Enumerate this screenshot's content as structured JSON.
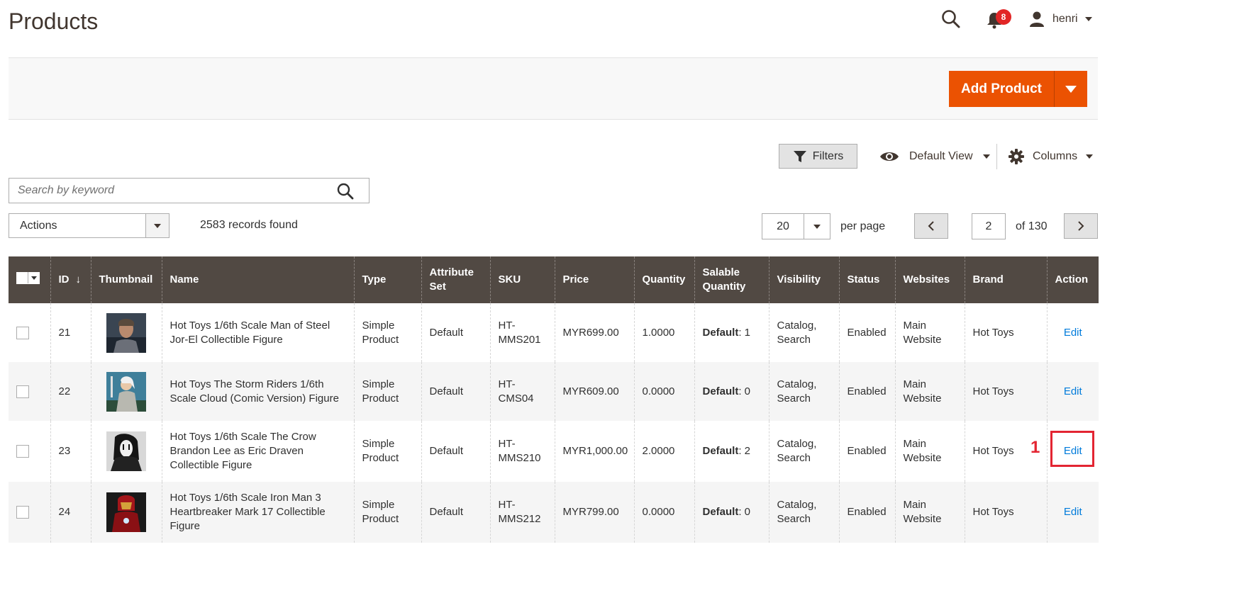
{
  "header": {
    "title": "Products",
    "notifications_count": "8",
    "username": "henri"
  },
  "toolbar": {
    "add_product_label": "Add Product"
  },
  "controls": {
    "filters_label": "Filters",
    "view_label": "Default View",
    "columns_label": "Columns",
    "search_placeholder": "Search by keyword",
    "actions_label": "Actions",
    "records_found": "2583 records found",
    "per_page_value": "20",
    "per_page_label": "per page",
    "current_page": "2",
    "total_pages_label": "of 130"
  },
  "table": {
    "columns": [
      "ID",
      "Thumbnail",
      "Name",
      "Type",
      "Attribute Set",
      "SKU",
      "Price",
      "Quantity",
      "Salable Quantity",
      "Visibility",
      "Status",
      "Websites",
      "Brand",
      "Action"
    ],
    "rows": [
      {
        "id": "21",
        "name": "Hot Toys 1/6th Scale Man of Steel Jor-El Collectible Figure",
        "type": "Simple Product",
        "attribute_set": "Default",
        "sku": "HT-MMS201",
        "price": "MYR699.00",
        "quantity": "1.0000",
        "salable_label": "Default",
        "salable_value": ": 1",
        "visibility": "Catalog, Search",
        "status": "Enabled",
        "websites": "Main Website",
        "brand": "Hot Toys",
        "action": "Edit"
      },
      {
        "id": "22",
        "name": "Hot Toys The Storm Riders 1/6th Scale Cloud (Comic Version) Figure",
        "type": "Simple Product",
        "attribute_set": "Default",
        "sku": "HT-CMS04",
        "price": "MYR609.00",
        "quantity": "0.0000",
        "salable_label": "Default",
        "salable_value": ": 0",
        "visibility": "Catalog, Search",
        "status": "Enabled",
        "websites": "Main Website",
        "brand": "Hot Toys",
        "action": "Edit"
      },
      {
        "id": "23",
        "name": "Hot Toys 1/6th Scale The Crow Brandon Lee as Eric Draven Collectible Figure",
        "type": "Simple Product",
        "attribute_set": "Default",
        "sku": "HT-MMS210",
        "price": "MYR1,000.00",
        "quantity": "2.0000",
        "salable_label": "Default",
        "salable_value": ": 2",
        "visibility": "Catalog, Search",
        "status": "Enabled",
        "websites": "Main Website",
        "brand": "Hot Toys",
        "action": "Edit"
      },
      {
        "id": "24",
        "name": "Hot Toys 1/6th Scale Iron Man 3 Heartbreaker Mark 17 Collectible Figure",
        "type": "Simple Product",
        "attribute_set": "Default",
        "sku": "HT-MMS212",
        "price": "MYR799.00",
        "quantity": "0.0000",
        "salable_label": "Default",
        "salable_value": ": 0",
        "visibility": "Catalog, Search",
        "status": "Enabled",
        "websites": "Main Website",
        "brand": "Hot Toys",
        "action": "Edit"
      }
    ]
  },
  "annotation": {
    "number": "1"
  },
  "colors": {
    "brand_orange": "#eb5202",
    "header_dark": "#514943",
    "link_blue": "#007bdb",
    "annotation_red": "#e32532"
  }
}
